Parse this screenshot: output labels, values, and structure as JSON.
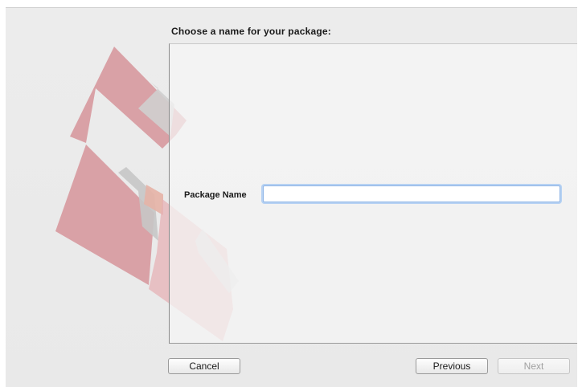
{
  "installer": {
    "prompt": "Choose a name for your package:",
    "field_label": "Package Name",
    "field_value": "",
    "field_placeholder": ""
  },
  "buttons": {
    "cancel": "Cancel",
    "previous": "Previous",
    "next": "Next",
    "next_enabled": false
  },
  "colors": {
    "logo_red": "#d6949a",
    "logo_gray": "#c7c7c7",
    "input_focus": "#8fb5e6"
  },
  "icons": {
    "background_logo": "package-logo"
  }
}
